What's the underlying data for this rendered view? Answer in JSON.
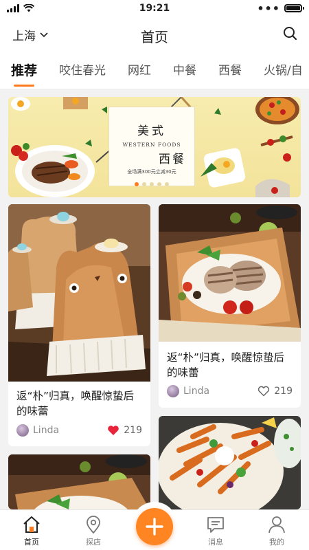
{
  "status_bar": {
    "time": "19:21",
    "battery_level": 1.0
  },
  "header": {
    "city": "上海",
    "title": "首页"
  },
  "tabs": [
    {
      "label": "推荐",
      "active": true
    },
    {
      "label": "咬住春光",
      "active": false
    },
    {
      "label": "网红",
      "active": false
    },
    {
      "label": "中餐",
      "active": false
    },
    {
      "label": "西餐",
      "active": false
    },
    {
      "label": "火锅/自",
      "active": false
    }
  ],
  "banner": {
    "title_part1": "美式",
    "title_part2": "西餐",
    "subtitle": "WESTERN FOODS",
    "promo": "全场满300元立减30元",
    "slide_count": 5,
    "active_slide": 1
  },
  "feed": [
    {
      "title": "返“朴”归真，唤醒惊蛰后的味蕾",
      "author": "Linda",
      "likes": "219",
      "liked": true,
      "image": "totoro-cream-puffs"
    },
    {
      "title": "返“朴”归真，唤醒惊蛰后的味蕾",
      "author": "Linda",
      "likes": "219",
      "liked": false,
      "image": "grilled-fish-plate"
    },
    {
      "title": "",
      "author": "",
      "likes": "",
      "liked": false,
      "image": "grilled-fish-plate"
    },
    {
      "title": "",
      "author": "",
      "likes": "",
      "liked": false,
      "image": "sweet-potato-fries-salad"
    }
  ],
  "colors": {
    "accent": "#ff7a1f",
    "heart": "#e8233c",
    "tab_active": "#111111"
  },
  "bottom_nav": [
    {
      "label": "首页",
      "icon": "home-icon",
      "active": true
    },
    {
      "label": "探店",
      "icon": "location-pin-icon",
      "active": false
    },
    {
      "label": "",
      "icon": "plus-icon",
      "active": false
    },
    {
      "label": "消息",
      "icon": "message-icon",
      "active": false
    },
    {
      "label": "我的",
      "icon": "user-icon",
      "active": false
    }
  ]
}
